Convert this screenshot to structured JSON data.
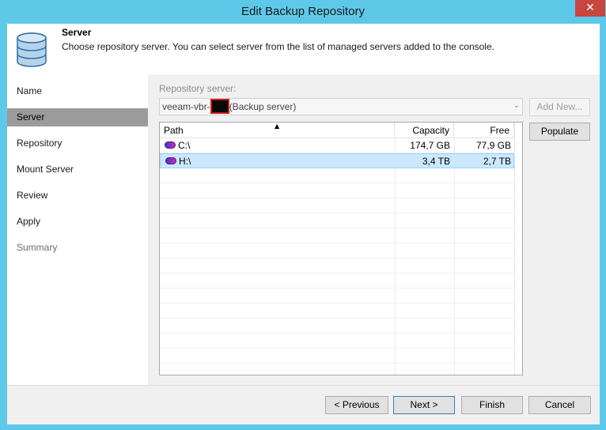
{
  "window": {
    "title": "Edit Backup Repository",
    "close_glyph": "✕"
  },
  "header": {
    "title": "Server",
    "description": "Choose repository server. You can select server from the list of managed servers added to the console."
  },
  "sidebar": {
    "items": [
      {
        "label": "Name",
        "state": "normal"
      },
      {
        "label": "Server",
        "state": "active"
      },
      {
        "label": "Repository",
        "state": "normal"
      },
      {
        "label": "Mount Server",
        "state": "normal"
      },
      {
        "label": "Review",
        "state": "normal"
      },
      {
        "label": "Apply",
        "state": "normal"
      },
      {
        "label": "Summary",
        "state": "disabled"
      }
    ]
  },
  "repository_server": {
    "label": "Repository server:",
    "value_prefix": "veeam-vbr-",
    "value_suffix": "(Backup server)",
    "add_new_label": "Add New...",
    "populate_label": "Populate"
  },
  "table": {
    "columns": [
      "Path",
      "Capacity",
      "Free"
    ],
    "sort_column": "Path",
    "rows": [
      {
        "path": "C:\\",
        "capacity": "174,7 GB",
        "free": "77,9 GB",
        "selected": false
      },
      {
        "path": "H:\\",
        "capacity": "3,4 TB",
        "free": "2,7 TB",
        "selected": true
      }
    ]
  },
  "footer": {
    "previous_label": "< Previous",
    "next_label": "Next >",
    "finish_label": "Finish",
    "cancel_label": "Cancel"
  },
  "colors": {
    "titlebar": "#5ec8e8",
    "close_button": "#c7463f",
    "selected_row": "#cce8ff",
    "active_nav": "#9b9b9b"
  }
}
